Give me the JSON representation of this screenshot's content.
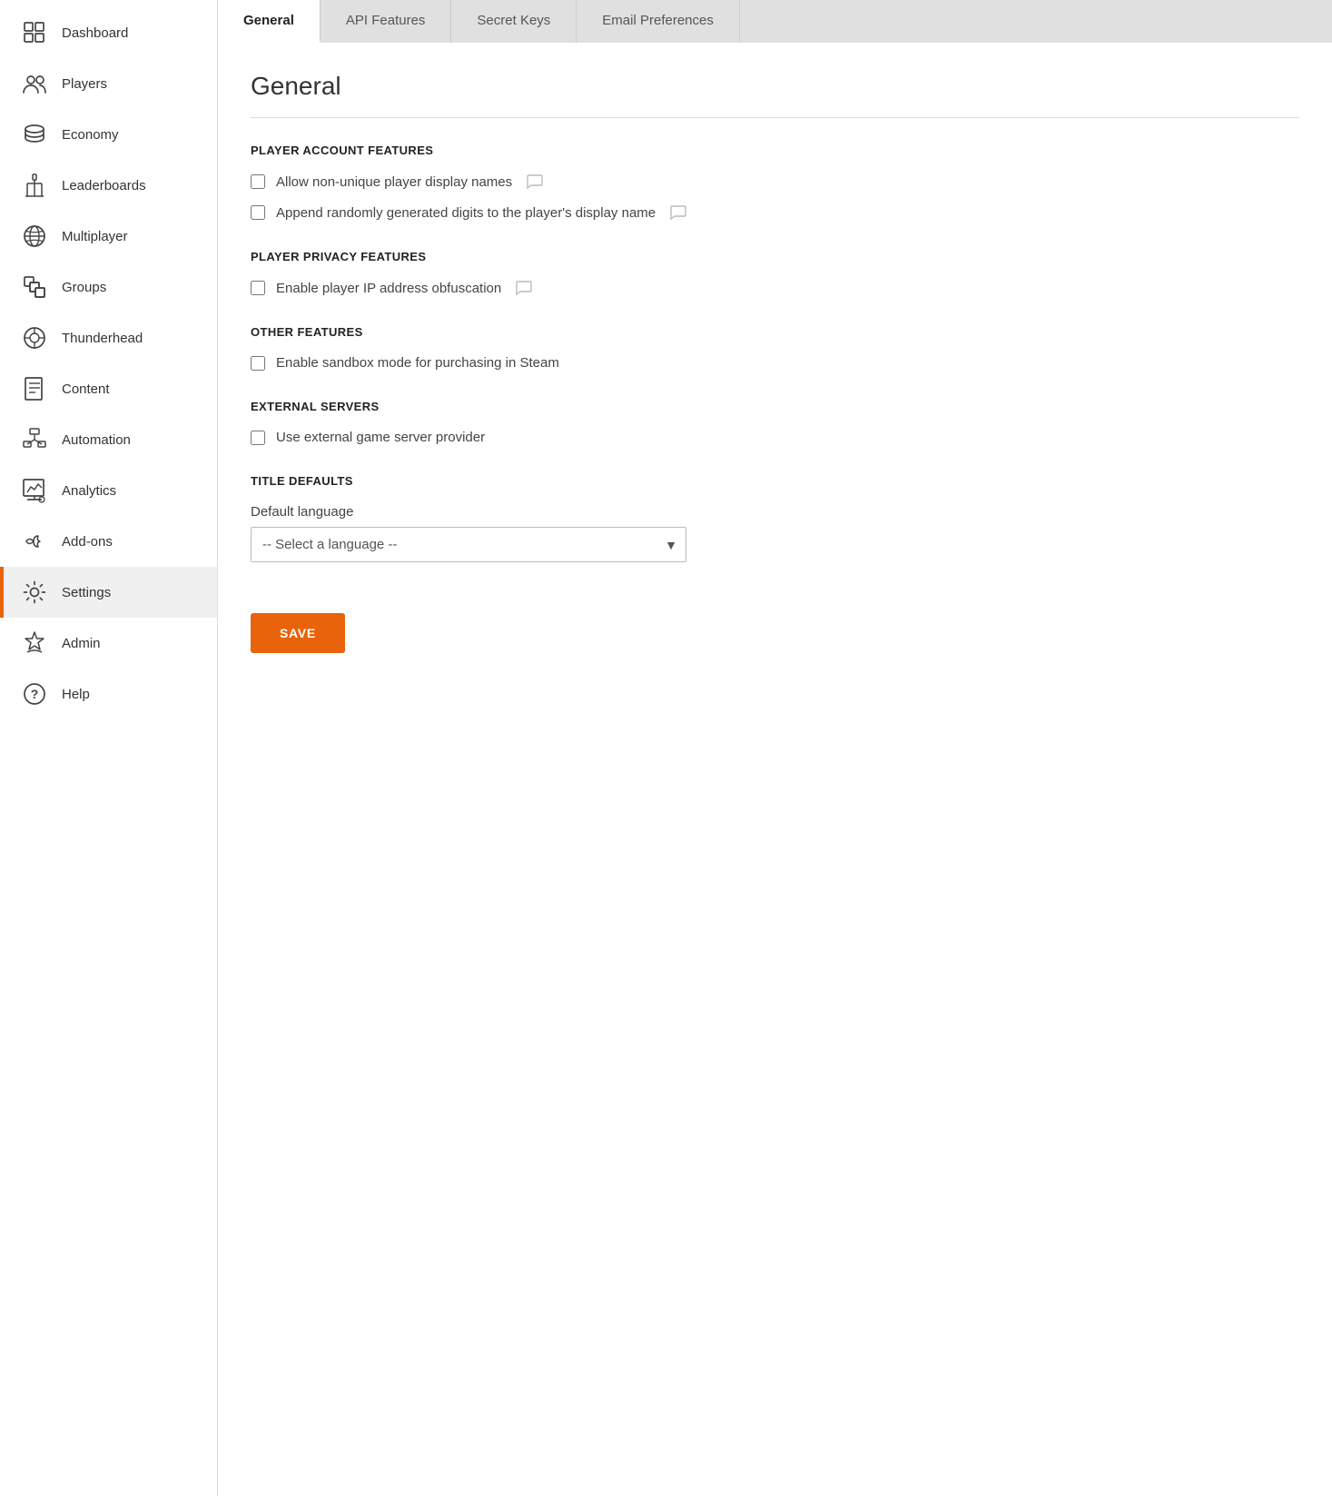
{
  "sidebar": {
    "items": [
      {
        "id": "dashboard",
        "label": "Dashboard",
        "active": false
      },
      {
        "id": "players",
        "label": "Players",
        "active": false
      },
      {
        "id": "economy",
        "label": "Economy",
        "active": false
      },
      {
        "id": "leaderboards",
        "label": "Leaderboards",
        "active": false
      },
      {
        "id": "multiplayer",
        "label": "Multiplayer",
        "active": false
      },
      {
        "id": "groups",
        "label": "Groups",
        "active": false
      },
      {
        "id": "thunderhead",
        "label": "Thunderhead",
        "active": false
      },
      {
        "id": "content",
        "label": "Content",
        "active": false
      },
      {
        "id": "automation",
        "label": "Automation",
        "active": false
      },
      {
        "id": "analytics",
        "label": "Analytics",
        "active": false
      },
      {
        "id": "addons",
        "label": "Add-ons",
        "active": false
      },
      {
        "id": "settings",
        "label": "Settings",
        "active": true
      },
      {
        "id": "admin",
        "label": "Admin",
        "active": false
      },
      {
        "id": "help",
        "label": "Help",
        "active": false
      }
    ]
  },
  "tabs": [
    {
      "id": "general",
      "label": "General",
      "active": true
    },
    {
      "id": "api-features",
      "label": "API Features",
      "active": false
    },
    {
      "id": "secret-keys",
      "label": "Secret Keys",
      "active": false
    },
    {
      "id": "email-preferences",
      "label": "Email Preferences",
      "active": false
    }
  ],
  "page": {
    "title": "General",
    "sections": [
      {
        "id": "player-account",
        "heading": "PLAYER ACCOUNT FEATURES",
        "items": [
          {
            "id": "non-unique-names",
            "label": "Allow non-unique player display names",
            "checked": false,
            "has_comment": true
          },
          {
            "id": "append-digits",
            "label": "Append randomly generated digits to the player's display name",
            "checked": false,
            "has_comment": true
          }
        ]
      },
      {
        "id": "player-privacy",
        "heading": "PLAYER PRIVACY FEATURES",
        "items": [
          {
            "id": "ip-obfuscation",
            "label": "Enable player IP address obfuscation",
            "checked": false,
            "has_comment": true
          }
        ]
      },
      {
        "id": "other-features",
        "heading": "OTHER FEATURES",
        "items": [
          {
            "id": "sandbox-steam",
            "label": "Enable sandbox mode for purchasing in Steam",
            "checked": false,
            "has_comment": false
          }
        ]
      },
      {
        "id": "external-servers",
        "heading": "EXTERNAL SERVERS",
        "items": [
          {
            "id": "external-server",
            "label": "Use external game server provider",
            "checked": false,
            "has_comment": false
          }
        ]
      }
    ],
    "title_defaults": {
      "heading": "TITLE DEFAULTS",
      "language_label": "Default language",
      "language_placeholder": "-- Select a language --",
      "language_options": [
        "-- Select a language --"
      ]
    },
    "save_button": "SAVE"
  }
}
